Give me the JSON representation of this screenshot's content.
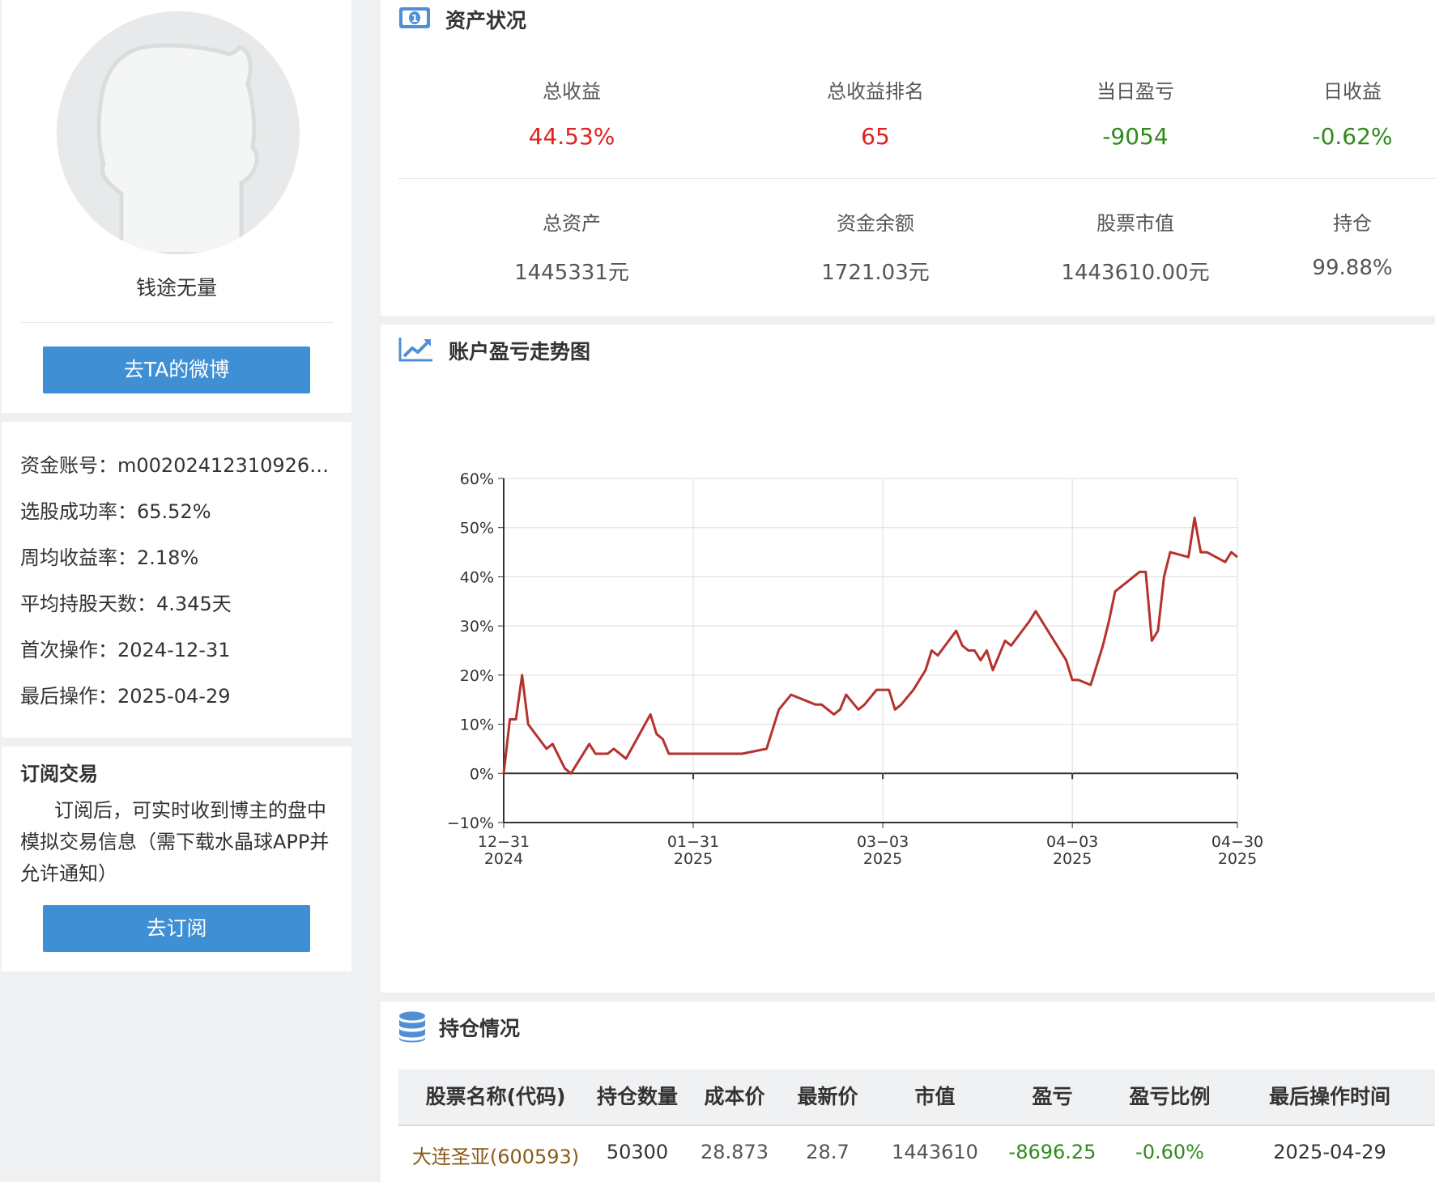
{
  "profile": {
    "username": "钱途无量",
    "weibo_button": "去TA的微博"
  },
  "stats": [
    {
      "label": "资金账号",
      "value": "m002024123109265..."
    },
    {
      "label": "选股成功率",
      "value": "65.52%"
    },
    {
      "label": "周均收益率",
      "value": "2.18%"
    },
    {
      "label": "平均持股天数",
      "value": "4.345天"
    },
    {
      "label": "首次操作",
      "value": "2024-12-31"
    },
    {
      "label": "最后操作",
      "value": "2025-04-29"
    }
  ],
  "subscribe": {
    "title": "订阅交易",
    "description": "订阅后，可实时收到博主的盘中模拟交易信息（需下载水晶球APP并允许通知）",
    "button": "去订阅"
  },
  "assets": {
    "title": "资产状况",
    "icon": "money-bill-icon",
    "row1": [
      {
        "label": "总收益",
        "value": "44.53%",
        "color": "#e0201f"
      },
      {
        "label": "总收益排名",
        "value": "65",
        "color": "#e0201f"
      },
      {
        "label": "当日盈亏",
        "value": "-9054",
        "color": "#2f8a1c"
      },
      {
        "label": "日收益",
        "value": "-0.62%",
        "color": "#2f8a1c"
      }
    ],
    "row2": [
      {
        "label": "总资产",
        "value": "1445331元"
      },
      {
        "label": "资金余额",
        "value": "1721.03元"
      },
      {
        "label": "股票市值",
        "value": "1443610.00元"
      },
      {
        "label": "持仓",
        "value": "99.88%"
      }
    ]
  },
  "trend": {
    "title": "账户盈亏走势图",
    "icon": "trend-line-icon"
  },
  "chart_data": {
    "type": "line",
    "line_color": "#b5322d",
    "x_ticks": [
      {
        "date": "2024-12-31",
        "label1": "12−31",
        "label2": "2024"
      },
      {
        "date": "2025-01-31",
        "label1": "01−31",
        "label2": "2025"
      },
      {
        "date": "2025-03-03",
        "label1": "03−03",
        "label2": "2025"
      },
      {
        "date": "2025-04-03",
        "label1": "04−03",
        "label2": "2025"
      },
      {
        "date": "2025-04-30",
        "label1": "04−30",
        "label2": "2025"
      }
    ],
    "y_ticks": [
      "−10%",
      "0%",
      "10%",
      "20%",
      "30%",
      "40%",
      "50%",
      "60%"
    ],
    "ylim": [
      -10,
      60
    ],
    "xlim": [
      "2024-12-31",
      "2025-04-30"
    ],
    "grid": true,
    "series": [
      {
        "x": [
          "2024-12-31",
          "2025-01-01",
          "2025-01-02",
          "2025-01-03",
          "2025-01-04",
          "2025-01-07",
          "2025-01-08",
          "2025-01-10",
          "2025-01-11",
          "2025-01-14",
          "2025-01-15",
          "2025-01-17",
          "2025-01-18",
          "2025-01-20",
          "2025-01-24",
          "2025-01-25",
          "2025-01-26",
          "2025-01-27",
          "2025-01-28",
          "2025-02-03",
          "2025-02-08",
          "2025-02-12",
          "2025-02-13",
          "2025-02-14",
          "2025-02-16",
          "2025-02-20",
          "2025-02-21",
          "2025-02-23",
          "2025-02-24",
          "2025-02-25",
          "2025-02-27",
          "2025-02-28",
          "2025-03-02",
          "2025-03-04",
          "2025-03-05",
          "2025-03-06",
          "2025-03-08",
          "2025-03-10",
          "2025-03-11",
          "2025-03-12",
          "2025-03-15",
          "2025-03-16",
          "2025-03-17",
          "2025-03-18",
          "2025-03-19",
          "2025-03-20",
          "2025-03-21",
          "2025-03-23",
          "2025-03-24",
          "2025-03-27",
          "2025-03-28",
          "2025-04-02",
          "2025-04-03",
          "2025-04-04",
          "2025-04-06",
          "2025-04-08",
          "2025-04-09",
          "2025-04-10",
          "2025-04-14",
          "2025-04-15",
          "2025-04-16",
          "2025-04-17",
          "2025-04-18",
          "2025-04-19",
          "2025-04-22",
          "2025-04-23",
          "2025-04-24",
          "2025-04-25",
          "2025-04-28",
          "2025-04-29",
          "2025-04-30"
        ],
        "y": [
          0,
          11,
          11,
          20,
          10,
          5,
          6,
          1,
          0,
          6,
          4,
          4,
          5,
          3,
          12,
          8,
          7,
          4,
          4,
          4,
          4,
          5,
          9,
          13,
          16,
          14,
          14,
          12,
          13,
          16,
          13,
          14,
          17,
          17,
          13,
          14,
          17,
          21,
          25,
          24,
          29,
          26,
          25,
          25,
          23,
          25,
          21,
          27,
          26,
          31,
          33,
          23,
          19,
          19,
          18,
          26,
          31,
          37,
          41,
          41,
          27,
          29,
          40,
          45,
          44,
          52,
          45,
          45,
          43,
          45,
          44
        ]
      }
    ]
  },
  "holdings": {
    "title": "持仓情况",
    "icon": "database-icon",
    "columns": [
      "股票名称(代码)",
      "持仓数量",
      "成本价",
      "最新价",
      "市值",
      "盈亏",
      "盈亏比例",
      "最后操作时间"
    ],
    "rows": [
      {
        "name": "大连圣亚(600593)",
        "qty": "50300",
        "cost": "28.873",
        "price": "28.7",
        "mv": "1443610",
        "pl": "-8696.25",
        "pl_pct": "-0.60%",
        "last_op": "2025-04-29"
      }
    ]
  }
}
